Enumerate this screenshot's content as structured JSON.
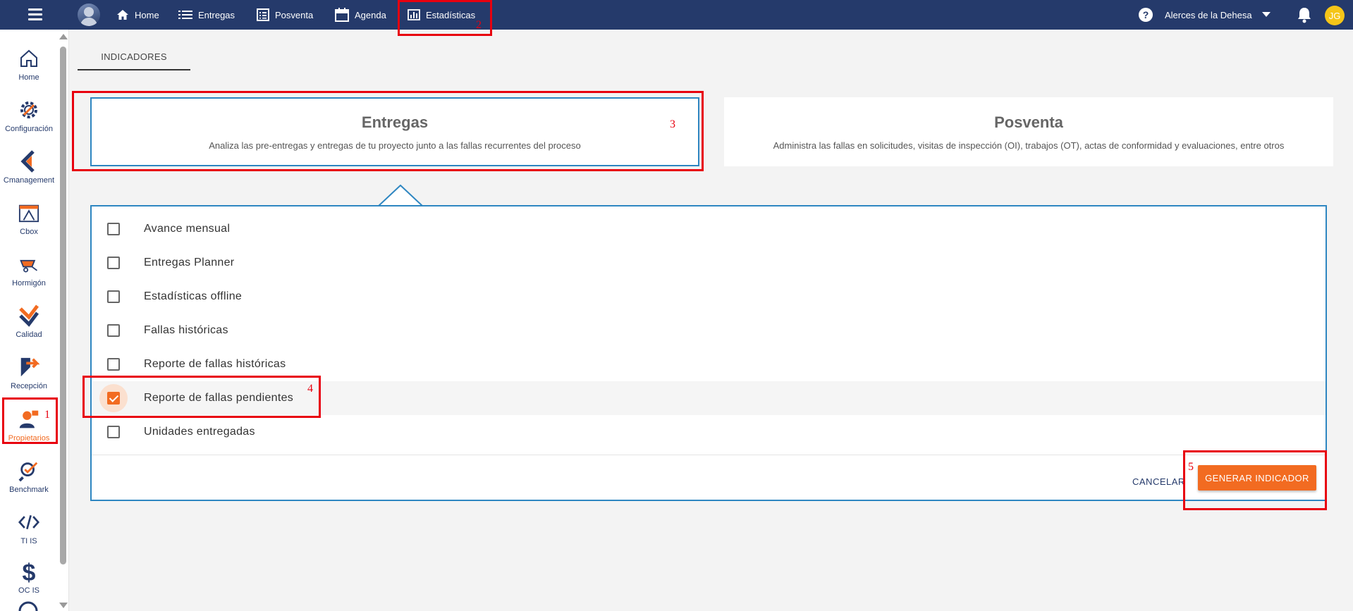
{
  "topbar": {
    "nav": [
      {
        "label": "Home",
        "icon": "home-icon"
      },
      {
        "label": "Entregas",
        "icon": "list-icon"
      },
      {
        "label": "Posventa",
        "icon": "checklist-icon"
      },
      {
        "label": "Agenda",
        "icon": "calendar-icon"
      },
      {
        "label": "Estadísticas",
        "icon": "bar-chart-icon"
      }
    ],
    "project": "Alerces de la Dehesa",
    "user_initials": "JG"
  },
  "sidebar": {
    "items": [
      {
        "label": "Home",
        "icon": "home-icon"
      },
      {
        "label": "Configuración",
        "icon": "gear-icon"
      },
      {
        "label": "Cmanagement",
        "icon": "cmanagement-icon"
      },
      {
        "label": "Cbox",
        "icon": "cbox-icon"
      },
      {
        "label": "Hormigón",
        "icon": "wheelbarrow-icon"
      },
      {
        "label": "Calidad",
        "icon": "quality-icon"
      },
      {
        "label": "Recepción",
        "icon": "reception-icon"
      },
      {
        "label": "Propietarios",
        "icon": "owners-icon"
      },
      {
        "label": "Benchmark",
        "icon": "benchmark-icon"
      },
      {
        "label": "TI IS",
        "icon": "code-icon"
      },
      {
        "label": "OC IS",
        "icon": "dollar-icon"
      }
    ],
    "active_label": "Propietarios"
  },
  "tabs": {
    "indicadores": "INDICADORES"
  },
  "cards": {
    "entregas": {
      "title": "Entregas",
      "desc": "Analiza las pre-entregas y entregas de tu proyecto junto a las fallas recurrentes del proceso"
    },
    "posventa": {
      "title": "Posventa",
      "desc": "Administra las fallas en solicitudes, visitas de inspección (OI), trabajos (OT), actas de conformidad y evaluaciones, entre otros"
    }
  },
  "indicators": {
    "rows": [
      {
        "label": "Avance mensual",
        "checked": false
      },
      {
        "label": "Entregas Planner",
        "checked": false
      },
      {
        "label": "Estadísticas offline",
        "checked": false
      },
      {
        "label": "Fallas históricas",
        "checked": false
      },
      {
        "label": "Reporte de fallas históricas",
        "checked": false
      },
      {
        "label": "Reporte de fallas pendientes",
        "checked": true
      },
      {
        "label": "Unidades entregadas",
        "checked": false
      }
    ],
    "cancel_label": "CANCELAR",
    "generate_label": "GENERAR INDICADOR"
  },
  "annotations": {
    "n1": "1",
    "n2": "2",
    "n3": "3",
    "n4": "4",
    "n5": "5"
  },
  "colors": {
    "topbar": "#253a6b",
    "accent": "#f26b21",
    "selection_border": "#2e86c1",
    "annotation": "#e8000f"
  }
}
